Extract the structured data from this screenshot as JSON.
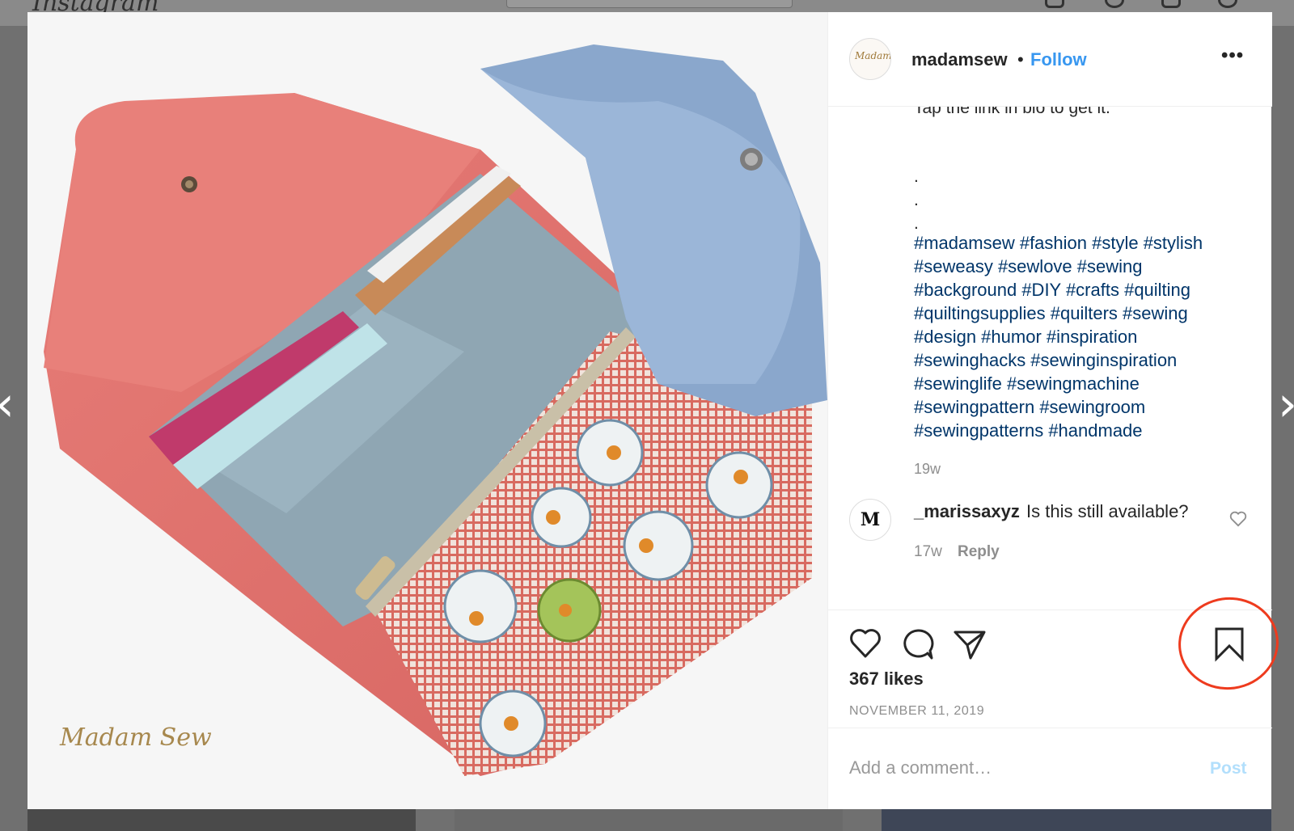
{
  "app": {
    "logo": "Instagram"
  },
  "post": {
    "header": {
      "username": "madamsew",
      "separator": "•",
      "follow_label": "Follow",
      "more_label": "•••",
      "avatar_text": "MadamSew"
    },
    "photo": {
      "watermark": "Madam Sew"
    },
    "caption": {
      "cut_line": "Tap the link in bio to get it.",
      "dots": [
        ".",
        ".",
        "."
      ],
      "hashtags": [
        "#madamsew",
        "#fashion",
        "#style",
        "#stylish",
        "#seweasy",
        "#sewlove",
        "#sewing",
        "#background",
        "#DIY",
        "#crafts",
        "#quilting",
        "#quiltingsupplies",
        "#quilters",
        "#sewing",
        "#design",
        "#humor",
        "#inspiration",
        "#sewinghacks",
        "#sewinginspiration",
        "#sewinglife",
        "#sewingmachine",
        "#sewingpattern",
        "#sewingroom",
        "#sewingpatterns",
        "#handmade"
      ],
      "hashtag_lines": [
        "#madamsew #fashion #style #stylish",
        "#seweasy #sewlove #sewing",
        "#background #DIY #crafts #quilting",
        "#quiltingsupplies #quilters #sewing",
        "#design #humor #inspiration",
        "#sewinghacks #sewinginspiration",
        "#sewinglife #sewingmachine",
        "#sewingpattern #sewingroom",
        "#sewingpatterns #handmade"
      ],
      "time": "19w"
    },
    "comment": {
      "avatar_letter": "M",
      "username": "_marissaxyz",
      "text": "Is this still available?",
      "time": "17w",
      "reply_label": "Reply"
    },
    "likes": "367 likes",
    "date": "NOVEMBER 11, 2019",
    "add_comment": {
      "placeholder": "Add a comment…",
      "post_label": "Post"
    },
    "icons": [
      "heart-icon",
      "comment-icon",
      "share-icon",
      "bookmark-icon",
      "more-icon"
    ]
  },
  "colors": {
    "link": "#3897f0",
    "hashtag": "#003569",
    "annotation": "#ee3b1e",
    "muted": "#8e8e8e",
    "post_disabled": "#b2dffc"
  }
}
